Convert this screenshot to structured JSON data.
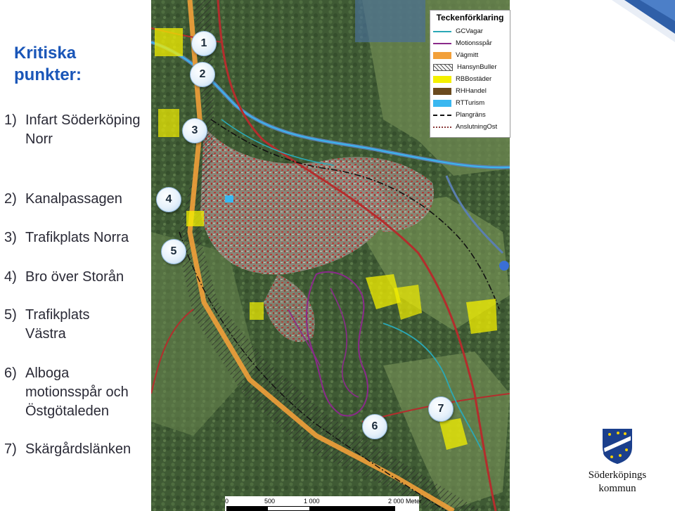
{
  "title_line1": "Kritiska",
  "title_line2": "punkter:",
  "points": [
    {
      "num": "1)",
      "text": "Infart Söderköping Norr"
    },
    {
      "num": "2)",
      "text": "Kanalpassagen"
    },
    {
      "num": "3)",
      "text": "Trafikplats Norra"
    },
    {
      "num": "4)",
      "text": "Bro över Storån"
    },
    {
      "num": "5)",
      "text": "Trafikplats Västra"
    },
    {
      "num": "6)",
      "text": "Alboga motionsspår och Östgötaleden"
    },
    {
      "num": "7)",
      "text": "Skärgårdslänken"
    }
  ],
  "markers": [
    "1",
    "2",
    "3",
    "4",
    "5",
    "6",
    "7"
  ],
  "legend": {
    "title": "Teckenförklaring",
    "items": [
      {
        "label": "GCVagar",
        "type": "line",
        "color": "#2aa8b6"
      },
      {
        "label": "Motionsspår",
        "type": "line",
        "color": "#8a2a8a"
      },
      {
        "label": "Vägmitt",
        "type": "fill",
        "color": "#f2a03a"
      },
      {
        "label": "HansynBuller",
        "type": "hatch",
        "color": "#555555"
      },
      {
        "label": "RBBostäder",
        "type": "fill",
        "color": "#f4f000"
      },
      {
        "label": "RHHandel",
        "type": "fill",
        "color": "#6b4a1e"
      },
      {
        "label": "RTTurism",
        "type": "fill",
        "color": "#3ab7f0"
      },
      {
        "label": "Plangräns",
        "type": "dashdot",
        "color": "#111111"
      },
      {
        "label": "AnslutningOst",
        "type": "dotted",
        "color": "#8a3a3a"
      }
    ]
  },
  "scale": {
    "labels": [
      "0",
      "500",
      "1 000",
      "2 000 Meter"
    ]
  },
  "logo": {
    "line1": "Söderköpings",
    "line2": "kommun"
  },
  "colors": {
    "title": "#1a56b8",
    "accent": "#1f6fd0"
  }
}
